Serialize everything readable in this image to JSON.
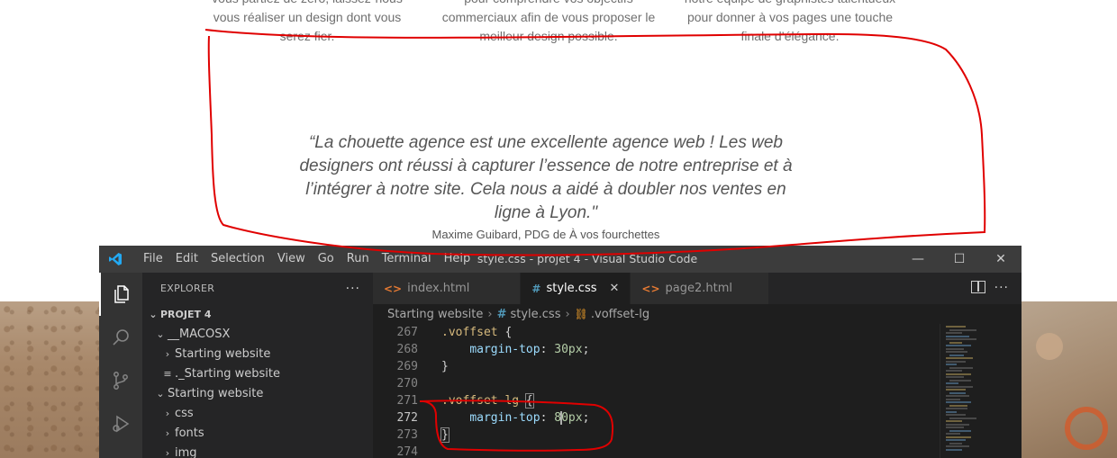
{
  "website": {
    "features": [
      [
        "vous partiez de zéro, laissez-nous",
        "vous réaliser un design dont vous",
        "serez fier."
      ],
      [
        "pour comprendre vos objectifs",
        "commerciaux afin de vous proposer le",
        "meilleur design possible."
      ],
      [
        "notre équipe de graphistes talentueux",
        "pour donner à vos pages une touche",
        "finale d’élégance."
      ]
    ],
    "testimonial": {
      "quote": "“La chouette agence est une excellente agence web ! Les web designers ont réussi à capturer l’essence de notre entreprise et à l’intégrer à notre site. Cela nous a aidé à doubler nos ventes en ligne à Lyon.\"",
      "author": "Maxime Guibard, PDG de À vos fourchettes"
    }
  },
  "vscode": {
    "window_title": "style.css - projet 4 - Visual Studio Code",
    "menu": [
      "File",
      "Edit",
      "Selection",
      "View",
      "Go",
      "Run",
      "Terminal",
      "Help"
    ],
    "window_controls": {
      "minimize": "—",
      "maximize": "☐",
      "close": "✕"
    },
    "explorer": {
      "title": "EXPLORER",
      "more": "···",
      "project": "PROJET 4",
      "tree": [
        {
          "label": "__MACOSX",
          "indent": 1,
          "chevron": "⌄"
        },
        {
          "label": "Starting website",
          "indent": 2,
          "chevron": "›"
        },
        {
          "label": "._Starting website",
          "indent": 2,
          "chevron": "≡"
        },
        {
          "label": "Starting website",
          "indent": 1,
          "chevron": "⌄"
        },
        {
          "label": "css",
          "indent": 2,
          "chevron": "›"
        },
        {
          "label": "fonts",
          "indent": 2,
          "chevron": "›"
        },
        {
          "label": "img",
          "indent": 2,
          "chevron": "›"
        }
      ]
    },
    "tabs": [
      {
        "label": "index.html",
        "icon": "<>",
        "type": "html"
      },
      {
        "label": "style.css",
        "icon": "#",
        "type": "css",
        "close": "✕"
      },
      {
        "label": "page2.html",
        "icon": "<>",
        "type": "html"
      }
    ],
    "tabs_more": "···",
    "breadcrumb": [
      "Starting website",
      "style.css",
      ".voffset-lg"
    ],
    "code_lines": [
      {
        "n": "267",
        "text": ".voffset {"
      },
      {
        "n": "268",
        "text": "    margin-top: 30px;"
      },
      {
        "n": "269",
        "text": "}"
      },
      {
        "n": "270",
        "text": ""
      },
      {
        "n": "271",
        "text": ".voffset-lg {"
      },
      {
        "n": "272",
        "text": "    margin-top: 80px;"
      },
      {
        "n": "273",
        "text": "}"
      },
      {
        "n": "274",
        "text": ""
      }
    ],
    "current_line": "272",
    "colors": {
      "title_bar": "#3c3c3c",
      "activity_bar": "#333333",
      "sidebar": "#252526",
      "editor": "#1e1e1e",
      "selector": "#d7ba7d",
      "property": "#9cdcfe",
      "number": "#b5cea8"
    }
  },
  "annotation_color": "#e00000"
}
